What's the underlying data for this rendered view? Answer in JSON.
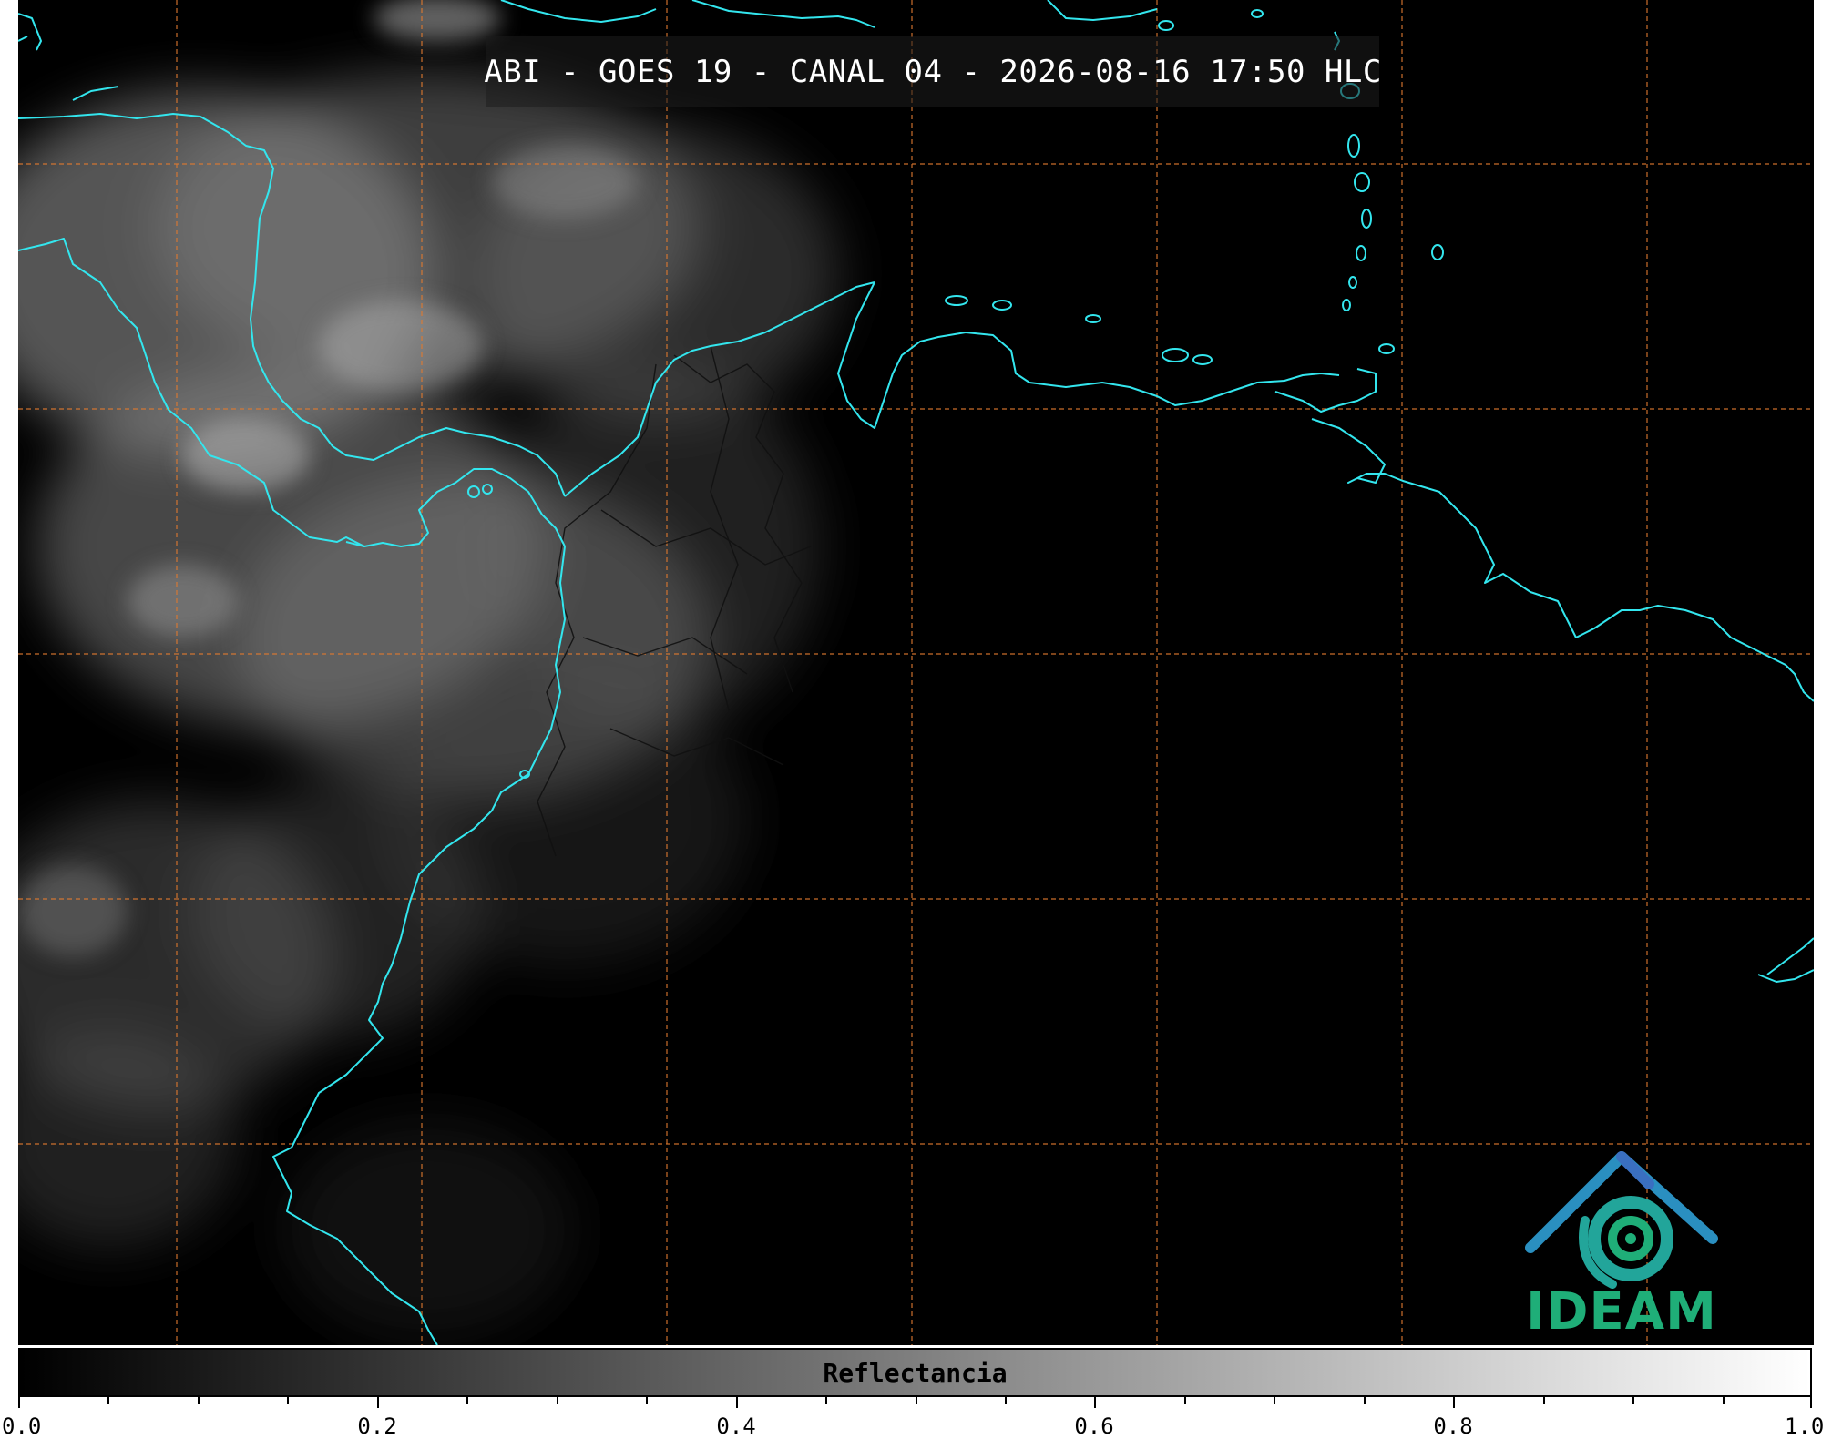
{
  "title": "ABI - GOES 19 - CANAL 04 - 2026-08-16 17:50 HLC",
  "colorbar": {
    "label": "Reflectancia",
    "min": 0.0,
    "max": 1.0,
    "major_ticks": [
      "0.0",
      "0.2",
      "0.4",
      "0.6",
      "0.8",
      "1.0"
    ],
    "minor_step": 0.05,
    "colors": {
      "low": "#000000",
      "high": "#ffffff"
    }
  },
  "map": {
    "background": "#000000",
    "coastline_color": "#33e6ee",
    "grid_color": "#e07a30",
    "cloud_color": "#9a9a9a"
  },
  "logo": {
    "text": "IDEAM",
    "colors": {
      "text": "#1fae78",
      "roof": "#2a8fc0",
      "swirl": "#22a59a"
    }
  }
}
